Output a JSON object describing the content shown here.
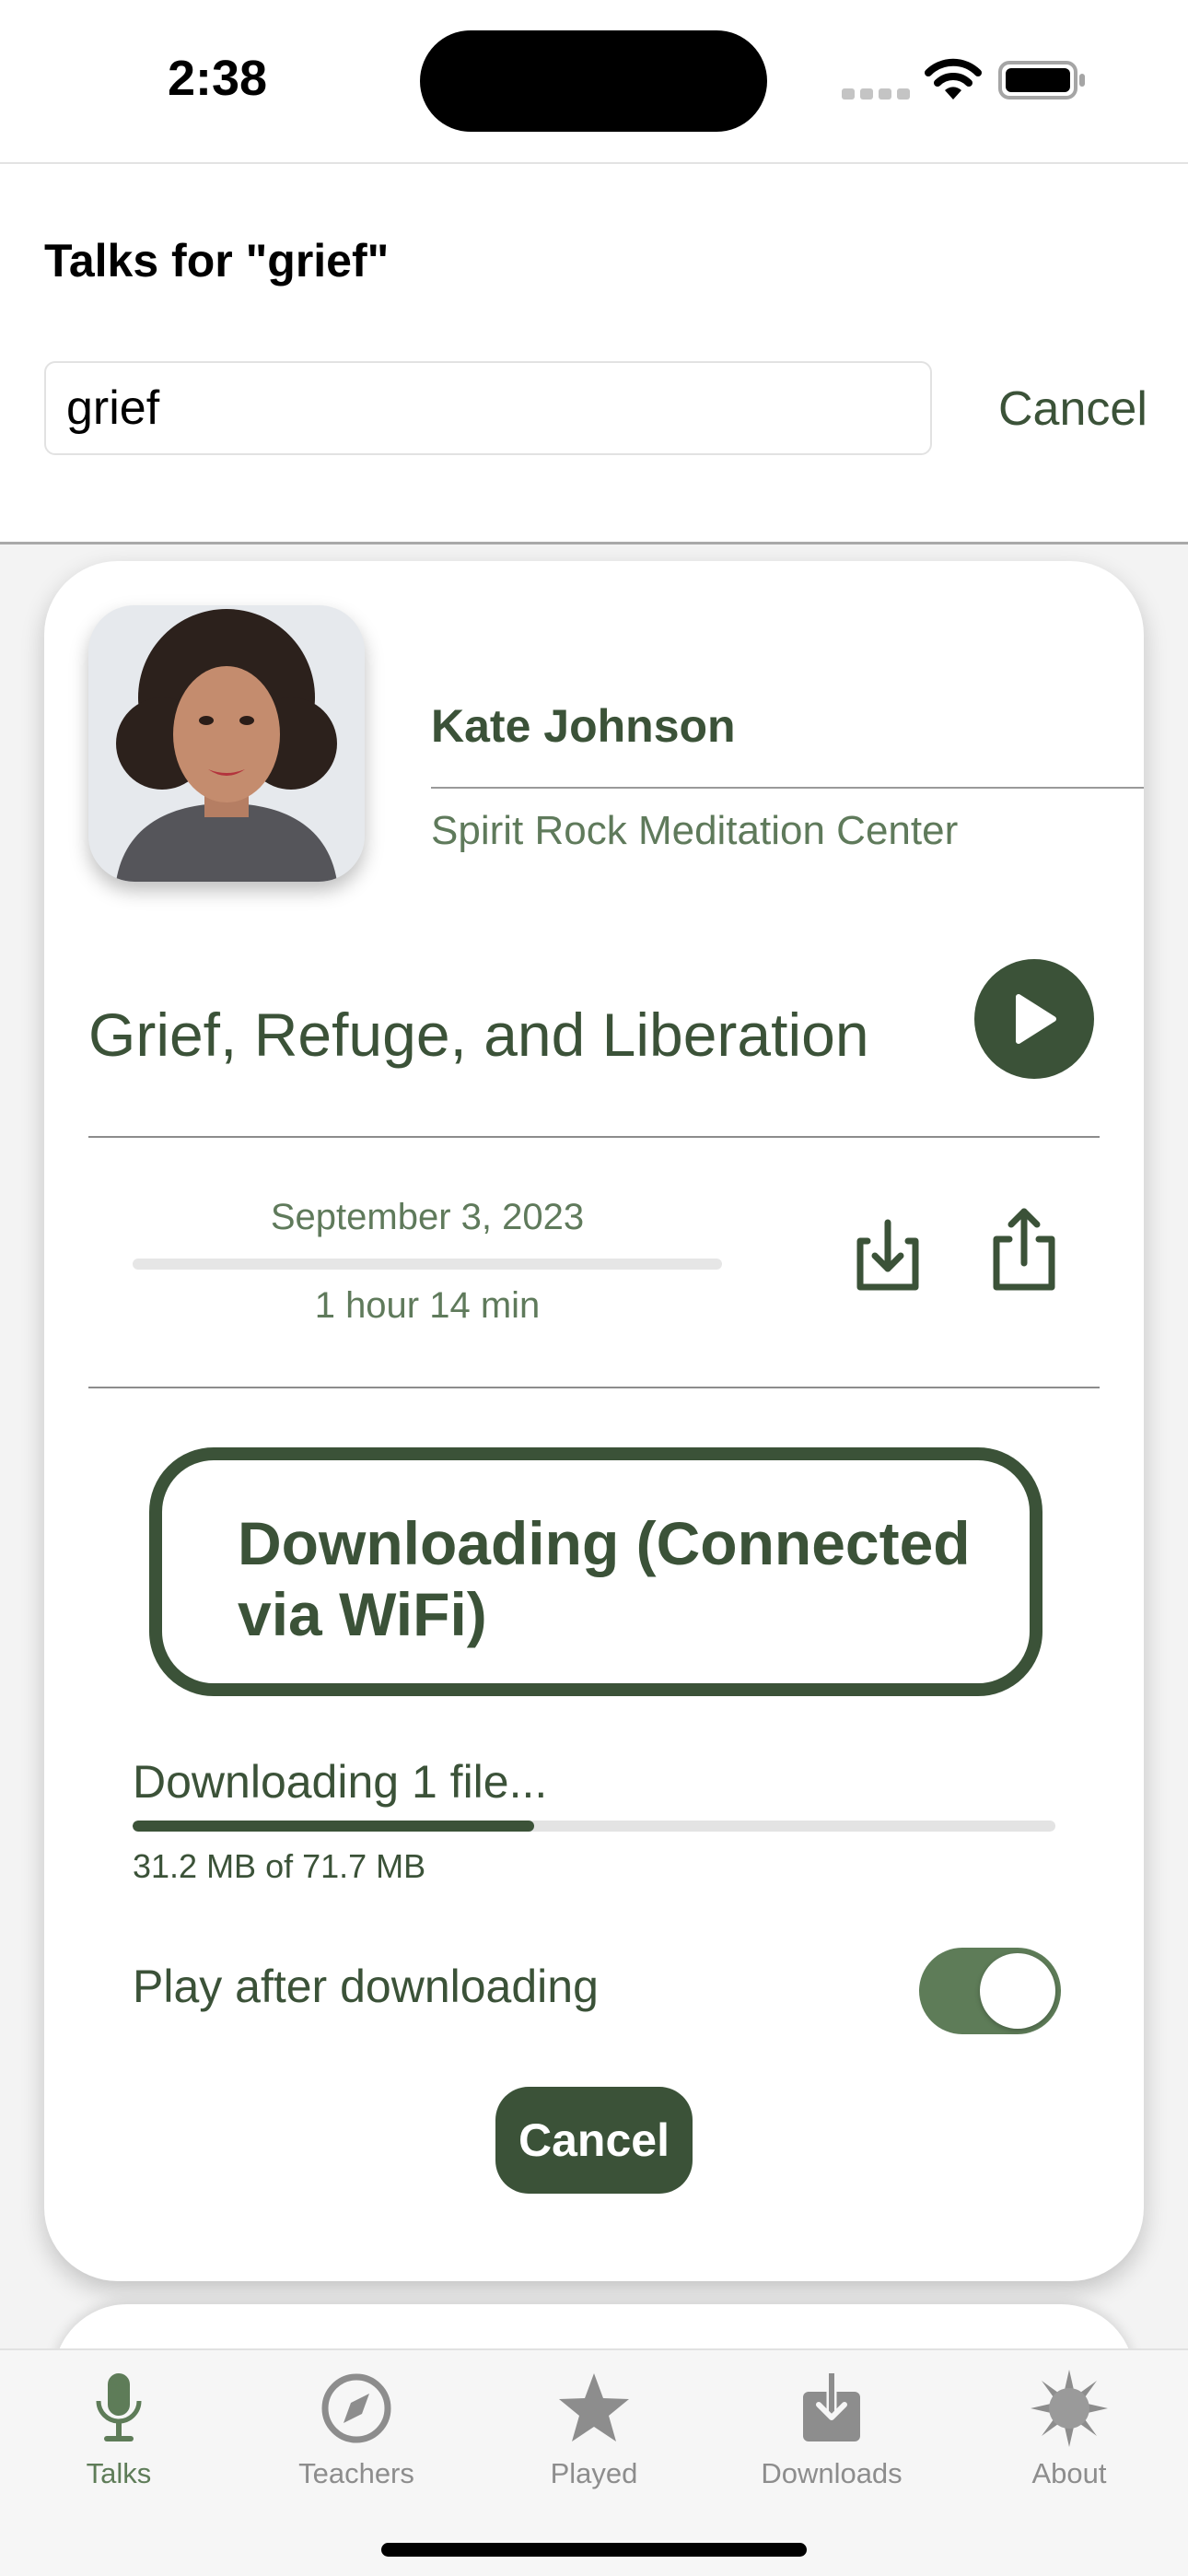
{
  "status_bar": {
    "time": "2:38"
  },
  "header": {
    "title": "Talks for \"grief\"",
    "search_value": "grief",
    "cancel_label": "Cancel"
  },
  "talk": {
    "teacher_name": "Kate Johnson",
    "center": "Spirit Rock Meditation Center",
    "title": "Grief, Refuge, and Liberation",
    "date": "September 3, 2023",
    "duration": "1 hour 14 min"
  },
  "download": {
    "status_text": "Downloading (Connected via WiFi)",
    "progress_label": "Downloading 1 file...",
    "progress_fraction": 0.435,
    "size_text": "31.2 MB of 71.7 MB",
    "play_after_label": "Play after downloading",
    "play_after_enabled": true,
    "cancel_label": "Cancel"
  },
  "tabs": [
    {
      "label": "Talks",
      "icon": "microphone-icon",
      "active": true
    },
    {
      "label": "Teachers",
      "icon": "compass-icon",
      "active": false
    },
    {
      "label": "Played",
      "icon": "star-icon",
      "active": false
    },
    {
      "label": "Downloads",
      "icon": "download-tray-icon",
      "active": false
    },
    {
      "label": "About",
      "icon": "sun-icon",
      "active": false
    }
  ],
  "colors": {
    "accent": "#3b5238",
    "accent_light": "#5e7c58",
    "secondary_text": "#5f7a5b",
    "inactive_tab": "#8d8d8d"
  }
}
